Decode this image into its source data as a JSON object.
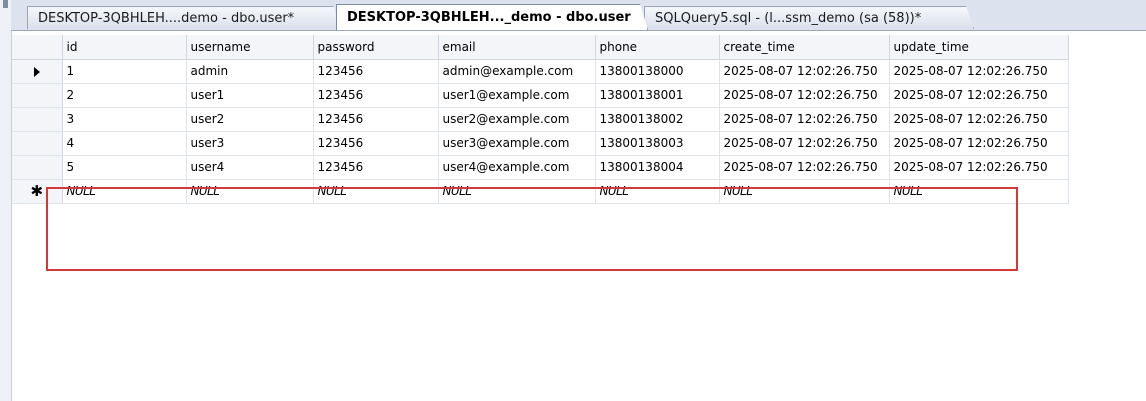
{
  "tabs": [
    {
      "label": "DESKTOP-3QBHLEH....demo - dbo.user*",
      "active": false
    },
    {
      "label": "DESKTOP-3QBHLEH..._demo - dbo.user",
      "active": true
    },
    {
      "label": "SQLQuery5.sql - (l...ssm_demo (sa (58))*",
      "active": false
    }
  ],
  "grid": {
    "columns": [
      "id",
      "username",
      "password",
      "email",
      "phone",
      "create_time",
      "update_time"
    ],
    "rows": [
      [
        "1",
        "admin",
        "123456",
        "admin@example.com",
        "13800138000",
        "2025-08-07 12:02:26.750",
        "2025-08-07 12:02:26.750"
      ],
      [
        "2",
        "user1",
        "123456",
        "user1@example.com",
        "13800138001",
        "2025-08-07 12:02:26.750",
        "2025-08-07 12:02:26.750"
      ],
      [
        "3",
        "user2",
        "123456",
        "user2@example.com",
        "13800138002",
        "2025-08-07 12:02:26.750",
        "2025-08-07 12:02:26.750"
      ],
      [
        "4",
        "user3",
        "123456",
        "user3@example.com",
        "13800138003",
        "2025-08-07 12:02:26.750",
        "2025-08-07 12:02:26.750"
      ],
      [
        "5",
        "user4",
        "123456",
        "user4@example.com",
        "13800138004",
        "2025-08-07 12:02:26.750",
        "2025-08-07 12:02:26.750"
      ]
    ],
    "new_row": [
      "NULL",
      "NULL",
      "NULL",
      "NULL",
      "NULL",
      "NULL",
      "NULL"
    ],
    "new_row_marker": "✱",
    "current_row_index": 0
  },
  "highlight_color": "#d23a3a"
}
